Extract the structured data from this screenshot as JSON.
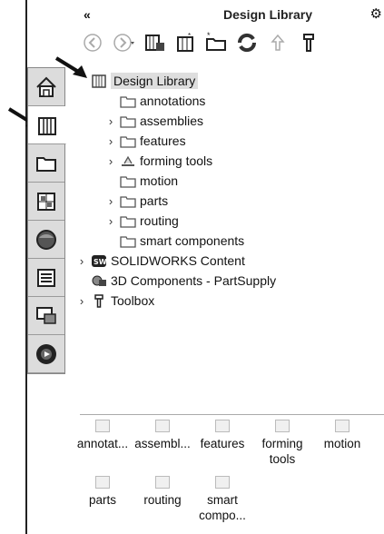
{
  "header": {
    "collapse_glyph": "«",
    "title": "Design Library",
    "gear_glyph": "⚙"
  },
  "toolbar": {
    "buttons": [
      "back-icon",
      "forward-icon",
      "add-to-library-icon",
      "add-file-location-icon",
      "create-new-folder-icon",
      "refresh-icon",
      "move-up-icon",
      "toolbox-icon"
    ]
  },
  "tree": {
    "root": "Design Library",
    "children": [
      {
        "label": "annotations",
        "expandable": false
      },
      {
        "label": "assemblies",
        "expandable": true
      },
      {
        "label": "features",
        "expandable": true
      },
      {
        "label": "forming tools",
        "expandable": true
      },
      {
        "label": "motion",
        "expandable": false
      },
      {
        "label": "parts",
        "expandable": true
      },
      {
        "label": "routing",
        "expandable": true
      },
      {
        "label": "smart components",
        "expandable": false
      }
    ],
    "solidworks_content": "SOLIDWORKS Content",
    "components_3d": "3D Components - PartSupply",
    "toolbox": "Toolbox"
  },
  "side_tabs": [
    "home-icon",
    "design-library-icon",
    "file-explorer-icon",
    "view-palette-icon",
    "appearances-icon",
    "custom-properties-icon",
    "solidworks-forum-icon",
    "video-icon"
  ],
  "grid_items": [
    {
      "label": "annotat..."
    },
    {
      "label": "assembl..."
    },
    {
      "label": "features"
    },
    {
      "label": "forming tools"
    },
    {
      "label": "motion"
    },
    {
      "label": "parts"
    },
    {
      "label": "routing"
    },
    {
      "label": "smart compo..."
    }
  ]
}
